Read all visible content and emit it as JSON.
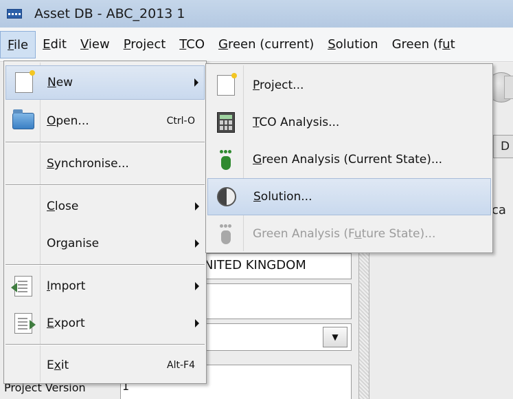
{
  "window": {
    "title": "Asset DB - ABC_2013 1"
  },
  "menubar": {
    "items": [
      {
        "pre": "",
        "ul": "F",
        "post": "ile"
      },
      {
        "pre": "",
        "ul": "E",
        "post": "dit"
      },
      {
        "pre": "",
        "ul": "V",
        "post": "iew"
      },
      {
        "pre": "",
        "ul": "P",
        "post": "roject"
      },
      {
        "pre": "",
        "ul": "T",
        "post": "CO"
      },
      {
        "pre": "",
        "ul": "G",
        "post": "reen (current)"
      },
      {
        "pre": "",
        "ul": "S",
        "post": "olution"
      },
      {
        "pre": "Green (f",
        "ul": "u",
        "post": "t"
      }
    ]
  },
  "file_menu": {
    "new": {
      "ul": "N",
      "post": "ew"
    },
    "open": {
      "ul": "O",
      "post": "pen...",
      "shortcut": "Ctrl-O"
    },
    "synchronise": {
      "ul": "S",
      "post": "ynchronise..."
    },
    "close": {
      "ul": "C",
      "post": "lose"
    },
    "organise": {
      "pre": "Or",
      "ul": "g",
      "post": "anise"
    },
    "import": {
      "ul": "I",
      "post": "mport"
    },
    "export": {
      "ul": "E",
      "post": "xport"
    },
    "exit": {
      "pre": "E",
      "ul": "x",
      "post": "it",
      "shortcut": "Alt-F4"
    }
  },
  "new_submenu": {
    "project": {
      "ul": "P",
      "post": "roject..."
    },
    "tco": {
      "ul": "T",
      "post": "CO Analysis..."
    },
    "green_current": {
      "ul": "G",
      "post": "reen Analysis (Current State)..."
    },
    "solution": {
      "ul": "S",
      "post": "olution..."
    },
    "green_future": {
      "pre": "Green Analysis (F",
      "ul": "u",
      "post": "ture State)..."
    }
  },
  "background": {
    "tab_label": "D",
    "partial_text": "ca",
    "country_value": "NITED KINGDOM",
    "project_version_label": "Project Version",
    "project_version_value": "1"
  },
  "icons": {
    "app": "app-grid-icon",
    "new": "new-document-icon",
    "open": "folder-open-icon",
    "import": "import-icon",
    "export": "export-icon",
    "project": "new-document-icon",
    "tco": "calculator-icon",
    "green_current": "footprint-green-icon",
    "solution": "solution-icon",
    "green_future": "footprint-grey-icon"
  }
}
